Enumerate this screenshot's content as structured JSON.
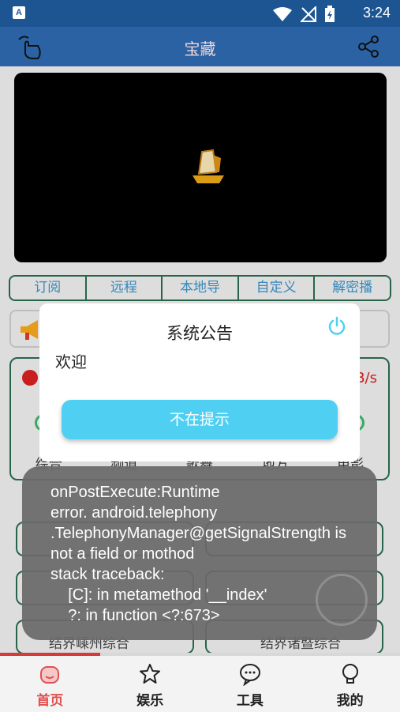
{
  "status_bar": {
    "time": "3:24",
    "app_badge": "A"
  },
  "title_bar": {
    "title": "宝藏"
  },
  "tabs": [
    "订阅",
    "远程",
    "本地导",
    "自定义",
    "解密播"
  ],
  "channel_card": {
    "speed": "B/s",
    "categories": [
      "综合",
      "频道",
      "歌舞",
      "地方",
      "电影"
    ]
  },
  "list_rows": [
    "结界嵊州综合",
    "结界诸暨综合"
  ],
  "modal": {
    "title": "系统公告",
    "body": "欢迎",
    "button": "不在提示"
  },
  "toast": {
    "lines": [
      "onPostExecute:Runtime",
      "error. android.telephony",
      ".TelephonyManager@getSignalStrength is",
      "not a field or mothod",
      "stack traceback:",
      "    [C]: in metamethod '__index'",
      "    ?: in function <?:673>"
    ]
  },
  "progress": {
    "fraction": 0.25
  },
  "bottom_nav": [
    {
      "label": "首页",
      "icon": "home-icon",
      "active": true
    },
    {
      "label": "娱乐",
      "icon": "star-icon",
      "active": false
    },
    {
      "label": "工具",
      "icon": "chat-icon",
      "active": false
    },
    {
      "label": "我的",
      "icon": "bulb-icon",
      "active": false
    }
  ],
  "colors": {
    "header": "#2a62a4",
    "accent": "#4fd0f2",
    "active_nav": "#e25050"
  }
}
